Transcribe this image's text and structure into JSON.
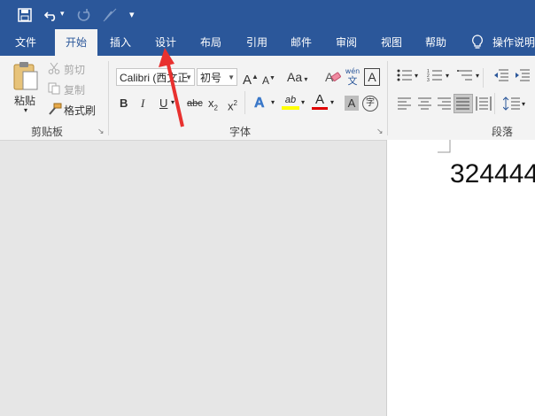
{
  "qat": {
    "save_icon": "save-icon",
    "undo_icon": "undo-icon",
    "redo_icon": "redo-icon",
    "touch_icon": "touch-mode-icon",
    "customize_icon": "customize-qat-icon"
  },
  "tabs": [
    "文件",
    "开始",
    "插入",
    "设计",
    "布局",
    "引用",
    "邮件",
    "审阅",
    "视图",
    "帮助"
  ],
  "active_tab": "开始",
  "tell_me": "操作说明",
  "clipboard": {
    "paste": "粘贴",
    "cut": "剪切",
    "copy": "复制",
    "format_painter": "格式刷",
    "group_label": "剪贴板"
  },
  "font": {
    "font_name": "Calibri (西文正",
    "font_size": "初号",
    "grow": "A",
    "shrink": "A",
    "change_case": "Aa",
    "phonetic_top": "wén",
    "phonetic_bottom": "文",
    "char_border": "A",
    "bold": "B",
    "italic": "I",
    "underline": "U",
    "strike": "abc",
    "subscript": "x",
    "superscript": "x",
    "sub_mark": "2",
    "sup_mark": "2",
    "effects": "A",
    "highlight": "ab",
    "font_color": "A",
    "char_shading": "A",
    "enclose": "字",
    "group_label": "字体"
  },
  "paragraph": {
    "group_label": "段落"
  },
  "document": {
    "text": "324444"
  },
  "colors": {
    "ribbon_blue": "#2b579a",
    "highlight_yellow": "#ffff00",
    "font_red": "#e00000",
    "annotation_arrow": "#e8312f"
  }
}
